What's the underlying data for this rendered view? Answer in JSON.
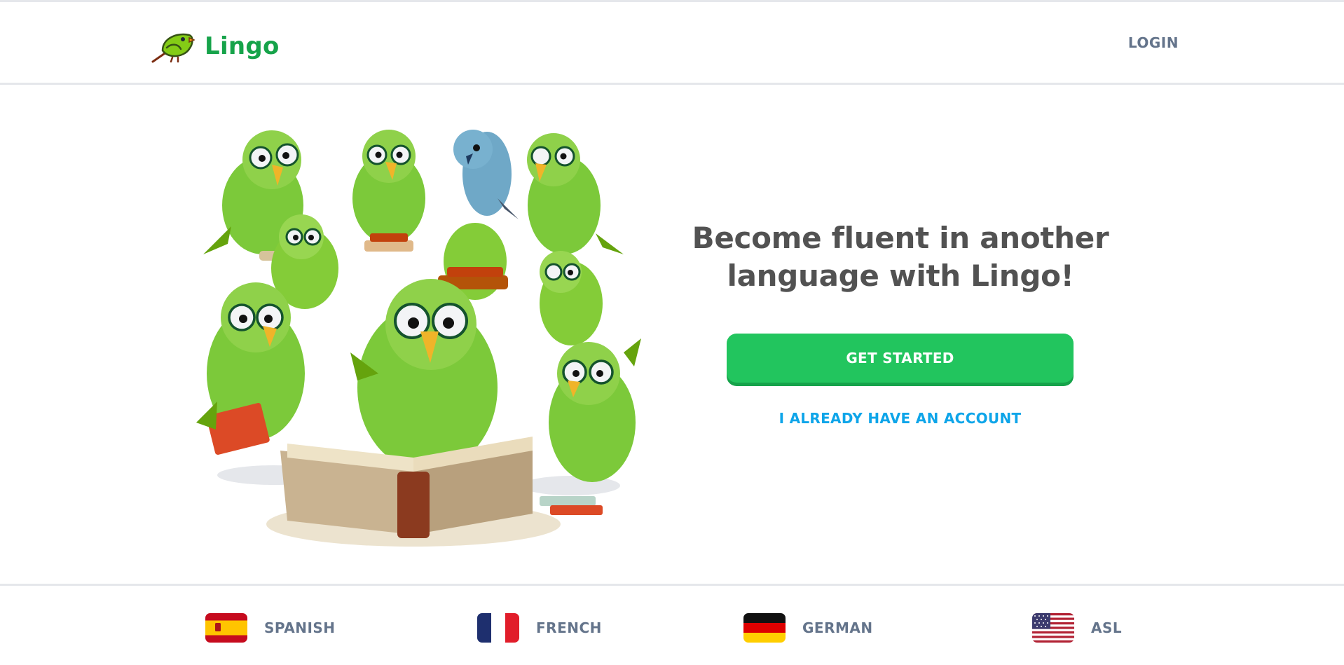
{
  "brand": {
    "name": "Lingo",
    "color": "#16a34a"
  },
  "header": {
    "login_label": "LOGIN"
  },
  "hero": {
    "headline_line1": "Become fluent in another",
    "headline_line2": "language with Lingo!",
    "get_started_label": "GET STARTED",
    "have_account_label": "I ALREADY HAVE AN ACCOUNT",
    "primary_color": "#22c55e",
    "link_color": "#0ea5e9"
  },
  "languages": [
    {
      "label": "SPANISH",
      "flag_icon": "spain-flag-icon"
    },
    {
      "label": "FRENCH",
      "flag_icon": "france-flag-icon"
    },
    {
      "label": "GERMAN",
      "flag_icon": "germany-flag-icon"
    },
    {
      "label": "ASL",
      "flag_icon": "usa-flag-icon"
    }
  ]
}
